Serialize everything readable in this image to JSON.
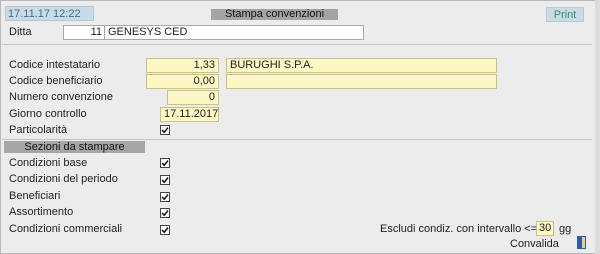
{
  "header": {
    "datetime": "17.11.17 12:22",
    "title": "Stampa convenzioni",
    "print_label": "Print"
  },
  "ditta": {
    "label": "Ditta",
    "code": "11",
    "name": "GENESYS CED"
  },
  "fields": {
    "codice_intestatario": {
      "label": "Codice intestatario",
      "value": "1,33",
      "description": "BURUGHI S.P.A."
    },
    "codice_beneficiario": {
      "label": "Codice beneficiario",
      "value": "0,00",
      "description": ""
    },
    "numero_convenzione": {
      "label": "Numero convenzione",
      "value": "0"
    },
    "giorno_controllo": {
      "label": "Giorno controllo",
      "value": "17.11.2017"
    },
    "particolarita": {
      "label": "Particolarità",
      "checked": true
    }
  },
  "sections": {
    "title": "Sezioni da stampare",
    "items": [
      {
        "label": "Condizioni base",
        "checked": true
      },
      {
        "label": "Condizioni del periodo",
        "checked": true
      },
      {
        "label": "Beneficiari",
        "checked": true
      },
      {
        "label": "Assortimento",
        "checked": true
      },
      {
        "label": "Condizioni commerciali",
        "checked": true
      }
    ]
  },
  "escludi": {
    "label": "Escludi condiz. con intervallo <= a",
    "value": "30",
    "unit": "gg"
  },
  "footer": {
    "convalida_label": "Convalida"
  }
}
